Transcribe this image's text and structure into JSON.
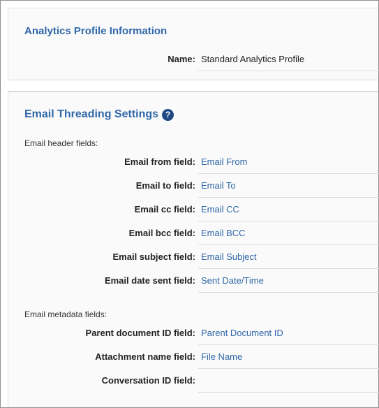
{
  "profile": {
    "title": "Analytics Profile Information",
    "name_label": "Name:",
    "name_value": "Standard Analytics Profile"
  },
  "email_threading": {
    "title": "Email Threading Settings",
    "help_icon": "question-circle-icon",
    "help_glyph": "?",
    "header_group_label": "Email header fields:",
    "header_fields": [
      {
        "label": "Email from field:",
        "value": "Email From"
      },
      {
        "label": "Email to field:",
        "value": "Email To"
      },
      {
        "label": "Email cc field:",
        "value": "Email CC"
      },
      {
        "label": "Email bcc field:",
        "value": "Email BCC"
      },
      {
        "label": "Email subject field:",
        "value": "Email Subject"
      },
      {
        "label": "Email date sent field:",
        "value": "Sent Date/Time"
      }
    ],
    "metadata_group_label": "Email metadata fields:",
    "metadata_fields": [
      {
        "label": "Parent document ID field:",
        "value": "Parent Document ID"
      },
      {
        "label": "Attachment name field:",
        "value": "File Name"
      },
      {
        "label": "Conversation ID field:",
        "value": ""
      }
    ]
  },
  "colors": {
    "accent": "#2f67a8",
    "help_icon": "#1f4a86",
    "panel_bg": "#fafafa",
    "border": "#8f8f8f"
  }
}
